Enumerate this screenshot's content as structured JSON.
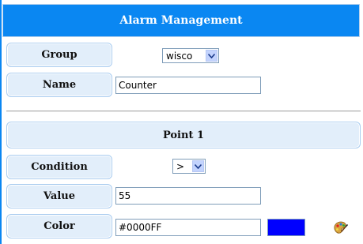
{
  "header": {
    "title": "Alarm Management"
  },
  "group": {
    "label": "Group",
    "selected": "wisco"
  },
  "name": {
    "label": "Name",
    "value": "Counter"
  },
  "point": {
    "title": "Point 1",
    "condition": {
      "label": "Condition",
      "selected": ">"
    },
    "value": {
      "label": "Value",
      "value": "55"
    },
    "color": {
      "label": "Color",
      "value": "#0000FF",
      "swatch": "#0000FF",
      "picker_icon": "palette-icon"
    }
  },
  "colors": {
    "title_bar": "#0A87F2",
    "label_cell": "#E2EEFA",
    "label_border": "#A8CBEF",
    "arrow_button": "#C3D3FD"
  }
}
